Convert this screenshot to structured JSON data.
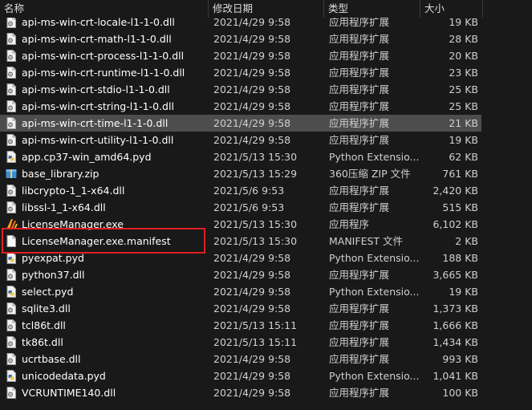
{
  "columns": {
    "name": "名称",
    "date": "修改日期",
    "type": "类型",
    "size": "大小"
  },
  "files": [
    {
      "name": "api-ms-win-crt-heap-l1-1-0.dll",
      "date": "2021/4/29 9:58",
      "type": "应用程序扩展",
      "size": "20 KB",
      "icon": "dll-icon"
    },
    {
      "name": "api-ms-win-crt-locale-l1-1-0.dll",
      "date": "2021/4/29 9:58",
      "type": "应用程序扩展",
      "size": "19 KB",
      "icon": "dll-icon"
    },
    {
      "name": "api-ms-win-crt-math-l1-1-0.dll",
      "date": "2021/4/29 9:58",
      "type": "应用程序扩展",
      "size": "28 KB",
      "icon": "dll-icon"
    },
    {
      "name": "api-ms-win-crt-process-l1-1-0.dll",
      "date": "2021/4/29 9:58",
      "type": "应用程序扩展",
      "size": "20 KB",
      "icon": "dll-icon"
    },
    {
      "name": "api-ms-win-crt-runtime-l1-1-0.dll",
      "date": "2021/4/29 9:58",
      "type": "应用程序扩展",
      "size": "23 KB",
      "icon": "dll-icon"
    },
    {
      "name": "api-ms-win-crt-stdio-l1-1-0.dll",
      "date": "2021/4/29 9:58",
      "type": "应用程序扩展",
      "size": "25 KB",
      "icon": "dll-icon"
    },
    {
      "name": "api-ms-win-crt-string-l1-1-0.dll",
      "date": "2021/4/29 9:58",
      "type": "应用程序扩展",
      "size": "25 KB",
      "icon": "dll-icon"
    },
    {
      "name": "api-ms-win-crt-time-l1-1-0.dll",
      "date": "2021/4/29 9:58",
      "type": "应用程序扩展",
      "size": "21 KB",
      "icon": "dll-icon",
      "selected": true
    },
    {
      "name": "api-ms-win-crt-utility-l1-1-0.dll",
      "date": "2021/4/29 9:58",
      "type": "应用程序扩展",
      "size": "19 KB",
      "icon": "dll-icon"
    },
    {
      "name": "app.cp37-win_amd64.pyd",
      "date": "2021/5/13 15:30",
      "type": "Python Extensio...",
      "size": "62 KB",
      "icon": "python-file-icon"
    },
    {
      "name": "base_library.zip",
      "date": "2021/5/13 15:29",
      "type": "360压缩 ZIP 文件",
      "size": "761 KB",
      "icon": "zip-archive-icon"
    },
    {
      "name": "libcrypto-1_1-x64.dll",
      "date": "2021/5/6 9:53",
      "type": "应用程序扩展",
      "size": "2,420 KB",
      "icon": "dll-icon"
    },
    {
      "name": "libssl-1_1-x64.dll",
      "date": "2021/5/6 9:53",
      "type": "应用程序扩展",
      "size": "515 KB",
      "icon": "dll-icon"
    },
    {
      "name": "LicenseManager.exe",
      "date": "2021/5/13 15:30",
      "type": "应用程序",
      "size": "6,102 KB",
      "icon": "app-logo-icon"
    },
    {
      "name": "LicenseManager.exe.manifest",
      "date": "2021/5/13 15:30",
      "type": "MANIFEST 文件",
      "size": "2 KB",
      "icon": "blank-file-icon"
    },
    {
      "name": "pyexpat.pyd",
      "date": "2021/4/29 9:58",
      "type": "Python Extensio...",
      "size": "188 KB",
      "icon": "python-file-icon"
    },
    {
      "name": "python37.dll",
      "date": "2021/4/29 9:58",
      "type": "应用程序扩展",
      "size": "3,665 KB",
      "icon": "dll-icon"
    },
    {
      "name": "select.pyd",
      "date": "2021/4/29 9:58",
      "type": "Python Extensio...",
      "size": "19 KB",
      "icon": "python-file-icon"
    },
    {
      "name": "sqlite3.dll",
      "date": "2021/4/29 9:58",
      "type": "应用程序扩展",
      "size": "1,373 KB",
      "icon": "dll-icon"
    },
    {
      "name": "tcl86t.dll",
      "date": "2021/5/13 15:11",
      "type": "应用程序扩展",
      "size": "1,666 KB",
      "icon": "dll-icon"
    },
    {
      "name": "tk86t.dll",
      "date": "2021/5/13 15:11",
      "type": "应用程序扩展",
      "size": "1,434 KB",
      "icon": "dll-icon"
    },
    {
      "name": "ucrtbase.dll",
      "date": "2021/4/29 9:58",
      "type": "应用程序扩展",
      "size": "993 KB",
      "icon": "dll-icon"
    },
    {
      "name": "unicodedata.pyd",
      "date": "2021/4/29 9:58",
      "type": "Python Extensio...",
      "size": "1,041 KB",
      "icon": "python-file-icon"
    },
    {
      "name": "VCRUNTIME140.dll",
      "date": "2021/4/29 9:58",
      "type": "应用程序扩展",
      "size": "100 KB",
      "icon": "dll-icon"
    }
  ],
  "colors": {
    "background": "#191919",
    "selected_row": "#4d4d4d",
    "highlight_box": "#e02020"
  }
}
